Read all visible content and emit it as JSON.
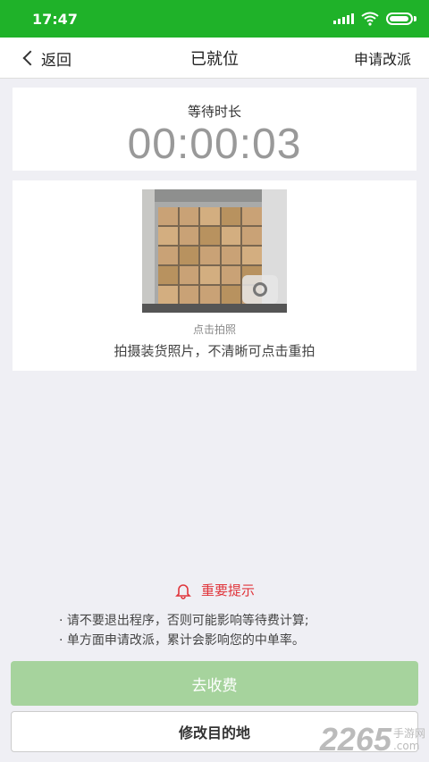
{
  "status_bar": {
    "time": "17:47"
  },
  "nav": {
    "back_label": "返回",
    "title": "已就位",
    "right_action": "申请改派"
  },
  "timer": {
    "label": "等待时长",
    "value": "00:00:03"
  },
  "photo": {
    "hint": "点击拍照",
    "description": "拍摄装货照片，不清晰可点击重拍"
  },
  "notice": {
    "title": "重要提示",
    "lines": [
      "· 请不要退出程序，否则可能影响等待费计算;",
      "· 单方面申请改派，累计会影响您的中单率。"
    ]
  },
  "buttons": {
    "primary": "去收费",
    "secondary": "修改目的地"
  },
  "watermark": {
    "brand": "2265",
    "sub": "手游网",
    "url": ".com"
  },
  "colors": {
    "brand_green": "#1fb229",
    "primary_button": "#a6d39d",
    "notice_red": "#e0353b",
    "timer_gray": "#999999"
  },
  "icons": [
    "signal-icon",
    "wifi-icon",
    "battery-icon",
    "back-chevron-icon",
    "camera-icon",
    "bell-icon"
  ]
}
